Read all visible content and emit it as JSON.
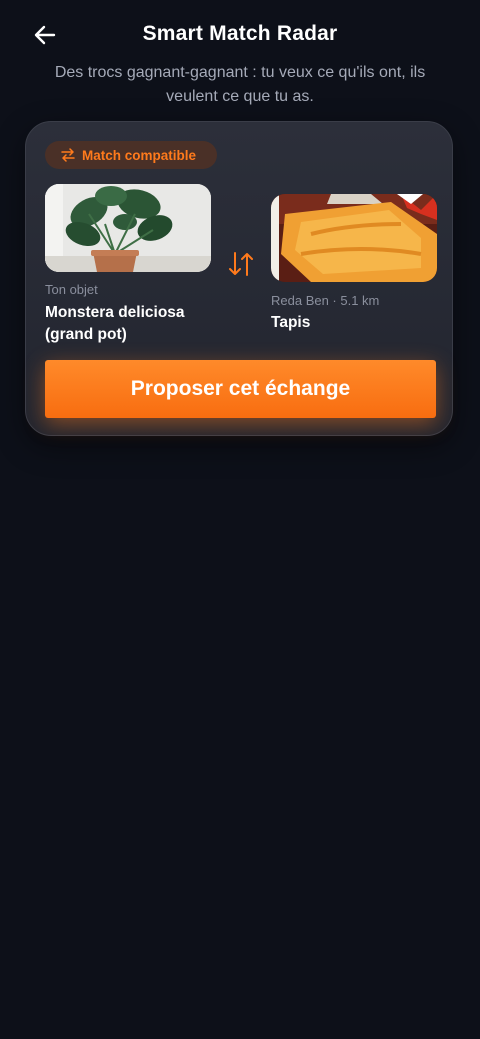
{
  "header": {
    "title": "Smart Match Radar",
    "back_icon": "arrow-left-icon"
  },
  "subtitle": "Des trocs gagnant-gagnant : tu veux ce qu'ils ont, ils veulent ce que tu as.",
  "match_card": {
    "badge": {
      "icon": "swap-horizontal-icon",
      "label": "Match compatible"
    },
    "swap_icon": "swap-vertical-icon",
    "my_item": {
      "owner_label": "Ton objet",
      "name": "Monstera deliciosa (grand pot)"
    },
    "their_item": {
      "owner_label": "Reda Ben · 5.1 km",
      "name": "Tapis"
    },
    "cta_label": "Proposer cet échange"
  },
  "colors": {
    "background": "#0d1019",
    "card": "#262933",
    "accent": "#ff7a1c",
    "muted_text": "#8a8f9d"
  }
}
